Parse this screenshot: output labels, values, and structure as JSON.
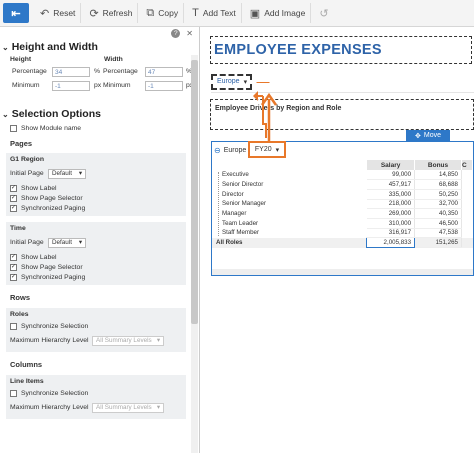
{
  "toolbar": {
    "reset": "Reset",
    "refresh": "Refresh",
    "copy": "Copy",
    "add_text": "Add Text",
    "add_image": "Add Image"
  },
  "panel": {
    "height_width": {
      "title": "Height and Width",
      "height_label": "Height",
      "width_label": "Width",
      "percentage_label": "Percentage",
      "minimum_label": "Minimum",
      "height_percentage": "34",
      "height_minimum": "-1",
      "width_percentage": "47",
      "width_minimum": "-1",
      "unit_percent": "%",
      "unit_px": "px"
    },
    "selection": {
      "title": "Selection Options",
      "show_module_name": "Show Module name",
      "pages_title": "Pages",
      "g1_region": {
        "title": "G1 Region",
        "initial_page_label": "Initial Page",
        "initial_page_value": "Default",
        "show_label": "Show Label",
        "show_page_selector": "Show Page Selector",
        "sync_paging": "Synchronized Paging"
      },
      "time": {
        "title": "Time",
        "initial_page_label": "Initial Page",
        "initial_page_value": "Default",
        "show_label": "Show Label",
        "show_page_selector": "Show Page Selector",
        "sync_paging": "Synchronized Paging"
      },
      "rows_title": "Rows",
      "roles": {
        "title": "Roles",
        "sync_selection": "Synchronize Selection",
        "max_level_label": "Maximum Hierarchy Level",
        "max_level_value": "All Summary Levels"
      },
      "columns_title": "Columns",
      "line_items": {
        "title": "Line Items",
        "sync_selection": "Synchronize Selection",
        "max_level_label": "Maximum Hierarchy Level",
        "max_level_value": "All Summary Levels"
      }
    }
  },
  "canvas": {
    "title": "EMPLOYEE EXPENSES",
    "region_selector": "Europe",
    "subtitle": "Employee Drivers by Region and Role",
    "move_label": "Move",
    "grid": {
      "page_region": "Europe",
      "page_time": "FY20",
      "columns": [
        "Salary",
        "Bonus",
        "C"
      ],
      "rows": [
        {
          "label": "Executive",
          "salary": "99,000",
          "bonus": "14,850"
        },
        {
          "label": "Senior Director",
          "salary": "457,917",
          "bonus": "68,688"
        },
        {
          "label": "Director",
          "salary": "335,000",
          "bonus": "50,250"
        },
        {
          "label": "Senior Manager",
          "salary": "218,000",
          "bonus": "32,700"
        },
        {
          "label": "Manager",
          "salary": "269,000",
          "bonus": "40,350"
        },
        {
          "label": "Team Leader",
          "salary": "310,000",
          "bonus": "46,500"
        },
        {
          "label": "Staff Member",
          "salary": "316,917",
          "bonus": "47,538"
        },
        {
          "label": "All Roles",
          "salary": "2,005,833",
          "bonus": "151,265"
        }
      ]
    }
  }
}
